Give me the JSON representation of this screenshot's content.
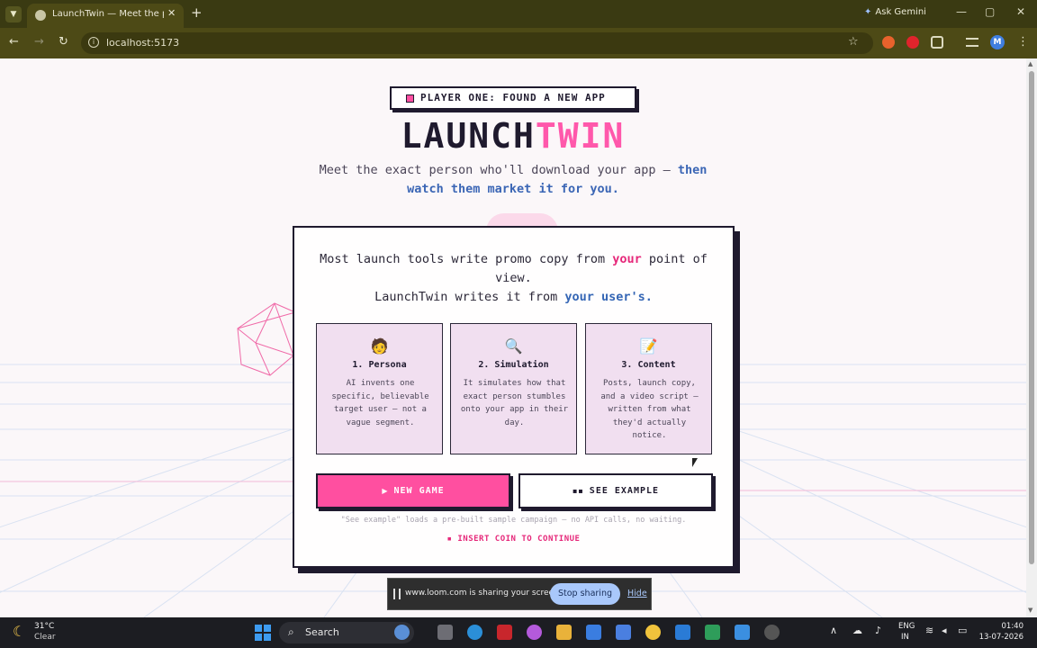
{
  "browser": {
    "tab_title": "LaunchTwin — Meet the person",
    "tab_close": "✕",
    "new_tab": "+",
    "ask_gemini": "Ask Gemini",
    "url": "localhost:5173",
    "profile_initial": "M",
    "window_controls": [
      "—",
      "▢",
      "✕"
    ]
  },
  "page": {
    "badge": "PLAYER ONE: FOUND A NEW APP",
    "logo_part1": "LAUNCH",
    "logo_part2": "TWIN",
    "tagline_plain": "Meet the exact person who'll download your app — ",
    "tagline_bold": "then watch them market it for you.",
    "intro_1": "Most launch tools write promo copy from ",
    "intro_your": "your",
    "intro_2": " point of view.",
    "intro_3": "LaunchTwin writes it from ",
    "intro_users": "your user's.",
    "features": [
      {
        "icon": "🧑",
        "title": "1. Persona",
        "desc": "AI invents one specific, believable target user — not a vague segment."
      },
      {
        "icon": "🔍",
        "title": "2. Simulation",
        "desc": "It simulates how that exact person stumbles onto your app in their day."
      },
      {
        "icon": "📝",
        "title": "3. Content",
        "desc": "Posts, launch copy, and a video script — written from what they'd actually notice."
      }
    ],
    "btn_new_glyph": "▶",
    "btn_new": "NEW GAME",
    "btn_example_glyph": "▪▪",
    "btn_example": "SEE EXAMPLE",
    "note": "\"See example\" loads a pre-built sample campaign — no API calls, no waiting.",
    "coin": "▪ INSERT COIN TO CONTINUE"
  },
  "share_banner": {
    "text": "www.loom.com is sharing your screen.",
    "stop": "Stop sharing",
    "hide": "Hide"
  },
  "taskbar": {
    "temp": "31°C",
    "condition": "Clear",
    "search": "Search",
    "lang_1": "ENG",
    "lang_2": "IN",
    "time": "01:40",
    "date": "13-07-2026"
  },
  "colors": {
    "accent_pink": "#ff4fa0",
    "accent_blue": "#3566b5",
    "ink": "#1f1a2e",
    "feature_bg": "#f1dff0",
    "browser_frame": "#4d4a16"
  }
}
